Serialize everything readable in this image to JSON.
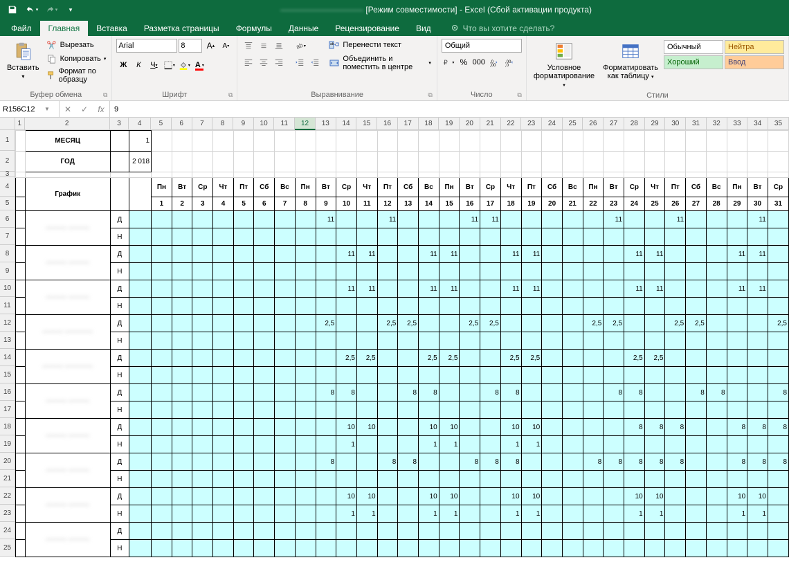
{
  "titlebar": {
    "title_suffix": "[Режим совместимости] - Excel (Сбой активации продукта)"
  },
  "tabs": {
    "file": "Файл",
    "items": [
      "Главная",
      "Вставка",
      "Разметка страницы",
      "Формулы",
      "Данные",
      "Рецензирование",
      "Вид"
    ],
    "active_index": 0,
    "tellme": "Что вы хотите сделать?"
  },
  "ribbon": {
    "clipboard": {
      "paste": "Вставить",
      "cut": "Вырезать",
      "copy": "Копировать",
      "format_painter": "Формат по образцу",
      "label": "Буфер обмена"
    },
    "font": {
      "name": "Arial",
      "size": "8",
      "bold": "Ж",
      "italic": "К",
      "underline": "Ч",
      "label": "Шрифт"
    },
    "alignment": {
      "wrap": "Перенести текст",
      "merge": "Объединить и поместить в центре",
      "label": "Выравнивание"
    },
    "number": {
      "format": "Общий",
      "label": "Число"
    },
    "styles": {
      "cond_fmt": "Условное форматирование",
      "format_table": "Форматировать как таблицу",
      "normal": "Обычный",
      "good": "Хороший",
      "neutral": "Нейтра",
      "input": "Ввод",
      "label": "Стили"
    }
  },
  "formula_bar": {
    "name_box": "R156C12",
    "value": "9"
  },
  "sheet": {
    "col_widths": {
      "1": 14,
      "2": 124,
      "3": 28,
      "4": 32,
      "day": 30
    },
    "month_label": "МЕСЯЦ",
    "month_value": "1",
    "year_label": "ГОД",
    "year_value": "2 018",
    "schedule_label": "График",
    "day_labels": [
      "Д",
      "Н"
    ],
    "weekdays": [
      "Пн",
      "Вт",
      "Ср",
      "Чт",
      "Пт",
      "Сб",
      "Вс",
      "Пн",
      "Вт",
      "Ср",
      "Чт",
      "Пт",
      "Сб",
      "Вс",
      "Пн",
      "Вт",
      "Ср",
      "Чт",
      "Пт",
      "Сб",
      "Вс",
      "Пн",
      "Вт",
      "Ср",
      "Чт",
      "Пт",
      "Сб",
      "Вс",
      "Пн",
      "Вт",
      "Ср"
    ],
    "days": [
      "1",
      "2",
      "3",
      "4",
      "5",
      "6",
      "7",
      "8",
      "9",
      "10",
      "11",
      "12",
      "13",
      "14",
      "15",
      "16",
      "17",
      "18",
      "19",
      "20",
      "21",
      "22",
      "23",
      "24",
      "25",
      "26",
      "27",
      "28",
      "29",
      "30",
      "31"
    ],
    "rows": [
      {
        "name": "——— ———",
        "d": {
          "9": "11",
          "12": "11",
          "16": "11",
          "17": "11",
          "23": "11",
          "26": "11",
          "30": "11"
        },
        "n": {}
      },
      {
        "name": "——— ———",
        "d": {
          "10": "11",
          "11": "11",
          "14": "11",
          "15": "11",
          "18": "11",
          "19": "11",
          "24": "11",
          "25": "11",
          "29": "11",
          "30": "11"
        },
        "n": {}
      },
      {
        "name": "——— ———",
        "d": {
          "10": "11",
          "11": "11",
          "14": "11",
          "15": "11",
          "18": "11",
          "19": "11",
          "24": "11",
          "25": "11",
          "29": "11",
          "30": "11"
        },
        "n": {}
      },
      {
        "name": "——— ————",
        "d": {
          "9": "2,5",
          "12": "2,5",
          "13": "2,5",
          "16": "2,5",
          "17": "2,5",
          "22": "2,5",
          "23": "2,5",
          "26": "2,5",
          "27": "2,5",
          "31": "2,5"
        },
        "n": {}
      },
      {
        "name": "——— ————",
        "d": {
          "10": "2,5",
          "11": "2,5",
          "14": "2,5",
          "15": "2,5",
          "18": "2,5",
          "19": "2,5",
          "24": "2,5",
          "25": "2,5"
        },
        "n": {}
      },
      {
        "name": "——— ———",
        "d": {
          "9": "8",
          "10": "8",
          "13": "8",
          "14": "8",
          "17": "8",
          "18": "8",
          "23": "8",
          "24": "8",
          "27": "8",
          "28": "8",
          "31": "8"
        },
        "n": {}
      },
      {
        "name": "——— ———",
        "d": {
          "10": "10",
          "11": "10",
          "14": "10",
          "15": "10",
          "18": "10",
          "19": "10",
          "24": "8",
          "25": "8",
          "26": "8",
          "29": "8",
          "30": "8",
          "31": "8"
        },
        "n": {
          "10": "1",
          "14": "1",
          "15": "1",
          "18": "1",
          "19": "1"
        }
      },
      {
        "name": "——— ———",
        "d": {
          "9": "8",
          "12": "8",
          "13": "8",
          "16": "8",
          "17": "8",
          "18": "8",
          "22": "8",
          "23": "8",
          "24": "8",
          "25": "8",
          "26": "8",
          "29": "8",
          "30": "8",
          "31": "8"
        },
        "n": {}
      },
      {
        "name": "——— ———",
        "d": {
          "10": "10",
          "11": "10",
          "14": "10",
          "15": "10",
          "18": "10",
          "19": "10",
          "24": "10",
          "25": "10",
          "29": "10",
          "30": "10"
        },
        "n": {
          "10": "1",
          "11": "1",
          "14": "1",
          "15": "1",
          "18": "1",
          "19": "1",
          "24": "1",
          "25": "1",
          "29": "1",
          "30": "1"
        }
      },
      {
        "name": "——— ———",
        "d": {},
        "n": {}
      }
    ]
  }
}
